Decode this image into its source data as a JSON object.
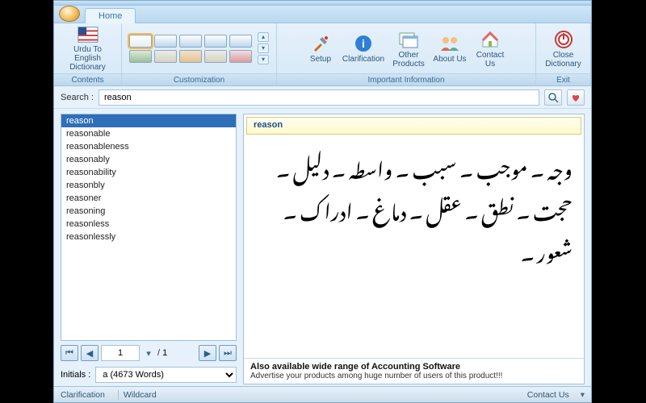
{
  "tabs": {
    "home": "Home"
  },
  "ribbon": {
    "contents": {
      "big_label": "Urdu To English\nDictionary",
      "group": "Contents"
    },
    "customization": {
      "group": "Customization"
    },
    "info": {
      "setup": "Setup",
      "clarification": "Clarification",
      "other": "Other\nProducts",
      "about": "About Us",
      "contact": "Contact\nUs",
      "group": "Important Information"
    },
    "exit": {
      "close": "Close\nDictionary",
      "group": "Exit"
    }
  },
  "search": {
    "label": "Search :",
    "value": "reason"
  },
  "wordlist": {
    "items": [
      "reason",
      "reasonable",
      "reasonableness",
      "reasonably",
      "reasonability",
      "reasonbly",
      "reasoner",
      "reasoning",
      "reasonless",
      "reasonlessly"
    ],
    "selected_index": 0
  },
  "pager": {
    "current": "1",
    "sep": "/",
    "total": "1"
  },
  "initials": {
    "label": "Initials :",
    "value": "a (4673 Words)"
  },
  "entry": {
    "headword": "reason",
    "definition_urdu": "وجہ ۔ موجب ۔ سبب ۔ واسطہ ۔ دلیل ۔ حجت ۔ نطق ۔ عقل ۔ دماغ ۔ ادراک ۔ شعور ۔"
  },
  "promo": {
    "line1": "Also available wide range of Accounting Software",
    "line2": "Advertise your products among huge number of users of this product!!!"
  },
  "status": {
    "clarification": "Clarification",
    "wildcard": "Wildcard",
    "contact": "Contact Us"
  }
}
